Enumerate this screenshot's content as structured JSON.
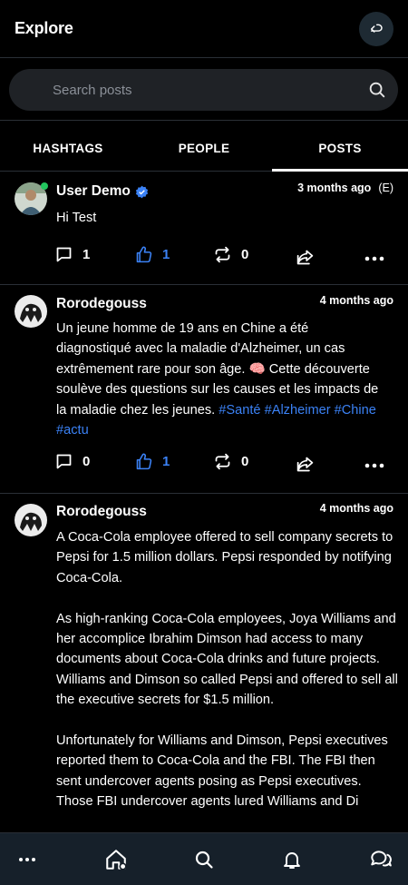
{
  "header": {
    "title": "Explore",
    "back_icon": "undo-icon"
  },
  "search": {
    "placeholder": "Search posts"
  },
  "tabs": [
    {
      "label": "HASHTAGS",
      "active": false
    },
    {
      "label": "PEOPLE",
      "active": false
    },
    {
      "label": "POSTS",
      "active": true
    }
  ],
  "posts": [
    {
      "author": "User Demo",
      "verified": true,
      "online": true,
      "time": "3 months ago",
      "edited": "(E)",
      "paragraphs": [
        "Hi Test"
      ],
      "comments": "1",
      "likes": "1",
      "reposts": "0"
    },
    {
      "author": "Rorodegouss",
      "time": "4 months ago",
      "lines": [
        "Un jeune homme de 19 ans en Chine a été",
        "diagnostiqué avec la maladie d'Alzheimer, un cas",
        "extrêmement rare pour son âge. 🧠 Cette découverte",
        "soulève des questions sur les causes et les impacts de",
        "la maladie chez les jeunes. "
      ],
      "hashtags_line1": "#Santé #Alzheimer #Chine",
      "hashtags_line2": "#actu",
      "comments": "0",
      "likes": "1",
      "reposts": "0"
    },
    {
      "author": "Rorodegouss",
      "time": "4 months ago",
      "paragraphs": [
        "A Coca-Cola employee offered to sell company secrets to Pepsi for 1.5 million dollars. Pepsi responded by notifying Coca-Cola.",
        "As high-ranking Coca-Cola employees, Joya Williams and her accomplice Ibrahim Dimson had access to many documents about Coca-Cola drinks and future projects. Williams and Dimson so called Pepsi and offered to sell all the executive secrets for $1.5 million.",
        "Unfortunately for Williams and Dimson, Pepsi executives reported them to Coca-Cola and the FBI. The FBI then sent undercover agents posing as Pepsi executives. Those FBI undercover agents lured Williams and Di"
      ]
    }
  ],
  "nav": [
    "more-icon",
    "home-icon",
    "search-icon",
    "bell-icon",
    "chat-icon"
  ],
  "colors": {
    "accent": "#3b82f6",
    "background": "#000000",
    "nav_background": "#16202a"
  }
}
